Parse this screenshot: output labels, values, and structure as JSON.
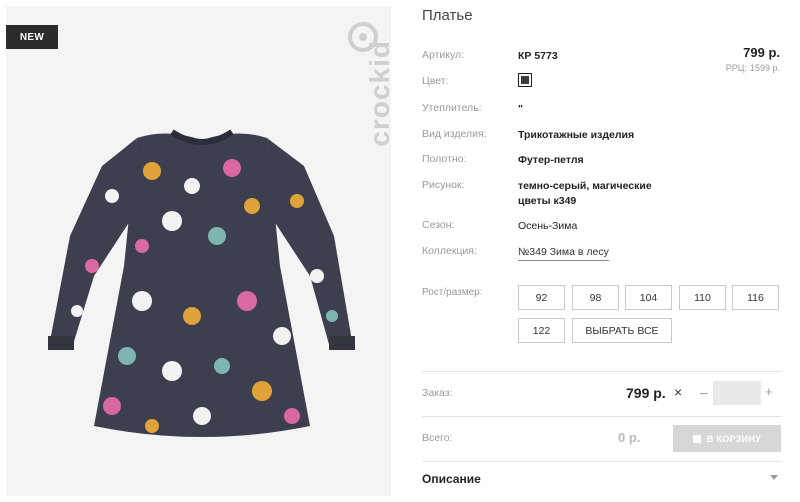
{
  "product": {
    "badge": "NEW",
    "brand": "crockid",
    "title": "Платье",
    "price": "799 р.",
    "rrp_label": "РРЦ:",
    "rrp_value": "1599 р."
  },
  "attributes": {
    "article": {
      "label": "Артикул:",
      "value": "КР 5773"
    },
    "color": {
      "label": "Цвет:",
      "swatch": "#3c3c3c"
    },
    "insulation": {
      "label": "Утеплитель:",
      "value": "\""
    },
    "type": {
      "label": "Вид изделия:",
      "value": "Трикотажные изделия"
    },
    "fabric": {
      "label": "Полотно:",
      "value": "Футер-петля"
    },
    "pattern": {
      "label": "Рисунок:",
      "value": "темно-серый, магические цветы к349"
    },
    "season": {
      "label": "Сезон:",
      "value": "Осень-Зима"
    },
    "collection": {
      "label": "Коллекция:",
      "value": "№349 Зима в лесу"
    }
  },
  "sizes": {
    "label": "Рост/размер:",
    "options": [
      "92",
      "98",
      "104",
      "110",
      "116",
      "122"
    ],
    "select_all": "ВЫБРАТЬ ВСЕ"
  },
  "order": {
    "label": "Заказ:",
    "price": "799 р.",
    "times": "×",
    "minus": "–",
    "plus": "+",
    "quantity": ""
  },
  "total": {
    "label": "Всего:",
    "value": "0 р.",
    "cart_button": "В КОРЗИНУ"
  },
  "description": {
    "label": "Описание"
  },
  "colors": {
    "dress": "#3d3f4f",
    "accent_pink": "#d86aa0",
    "accent_yellow": "#e0a33a",
    "accent_teal": "#7fb5b0"
  }
}
